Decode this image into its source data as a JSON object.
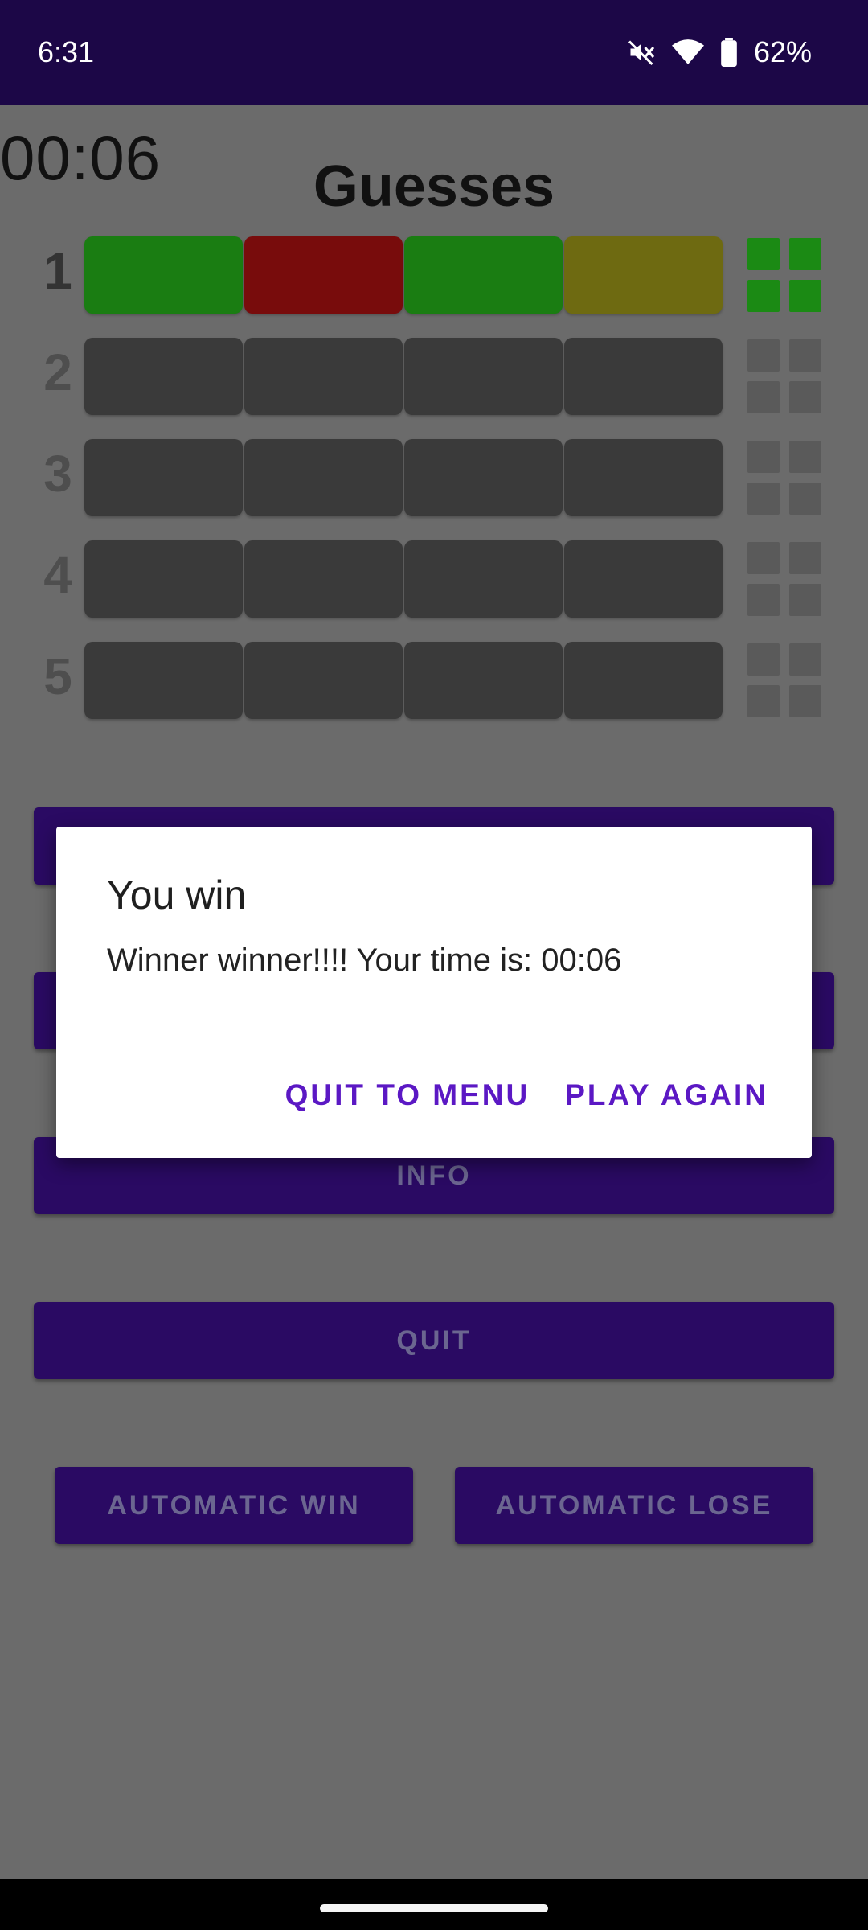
{
  "status": {
    "time": "6:31",
    "battery": "62%"
  },
  "game": {
    "timer": "00:06",
    "title": "Guesses",
    "rows": [
      {
        "number": "1",
        "slots": [
          "#1a7d12",
          "#780c0c",
          "#1a7d12",
          "#6e6a11"
        ],
        "pegs": [
          "#1b8a14",
          "#1b8a14",
          "#1b8a14",
          "#1b8a14"
        ]
      },
      {
        "number": "2",
        "slots": [
          "#3a3a3a",
          "#3a3a3a",
          "#3a3a3a",
          "#3a3a3a"
        ],
        "pegs": [
          "#5a5a5a",
          "#5a5a5a",
          "#5a5a5a",
          "#5a5a5a"
        ]
      },
      {
        "number": "3",
        "slots": [
          "#3a3a3a",
          "#3a3a3a",
          "#3a3a3a",
          "#3a3a3a"
        ],
        "pegs": [
          "#5a5a5a",
          "#5a5a5a",
          "#5a5a5a",
          "#5a5a5a"
        ]
      },
      {
        "number": "4",
        "slots": [
          "#3a3a3a",
          "#3a3a3a",
          "#3a3a3a",
          "#3a3a3a"
        ],
        "pegs": [
          "#5a5a5a",
          "#5a5a5a",
          "#5a5a5a",
          "#5a5a5a"
        ]
      },
      {
        "number": "5",
        "slots": [
          "#3a3a3a",
          "#3a3a3a",
          "#3a3a3a",
          "#3a3a3a"
        ],
        "pegs": [
          "#5a5a5a",
          "#5a5a5a",
          "#5a5a5a",
          "#5a5a5a"
        ]
      }
    ]
  },
  "buttons": {
    "info": "INFO",
    "quit": "QUIT",
    "auto_win": "AUTOMATIC WIN",
    "auto_lose": "AUTOMATIC LOSE"
  },
  "dialog": {
    "title": "You win",
    "message": "Winner winner!!!! Your time is: 00:06",
    "quit_to_menu": "QUIT TO MENU",
    "play_again": "PLAY AGAIN"
  },
  "colors": {
    "status_bar": "#1c0747",
    "button_bg": "#2a0a63",
    "dialog_accent": "#5b18c4",
    "scrim": "#6b6b6b"
  }
}
